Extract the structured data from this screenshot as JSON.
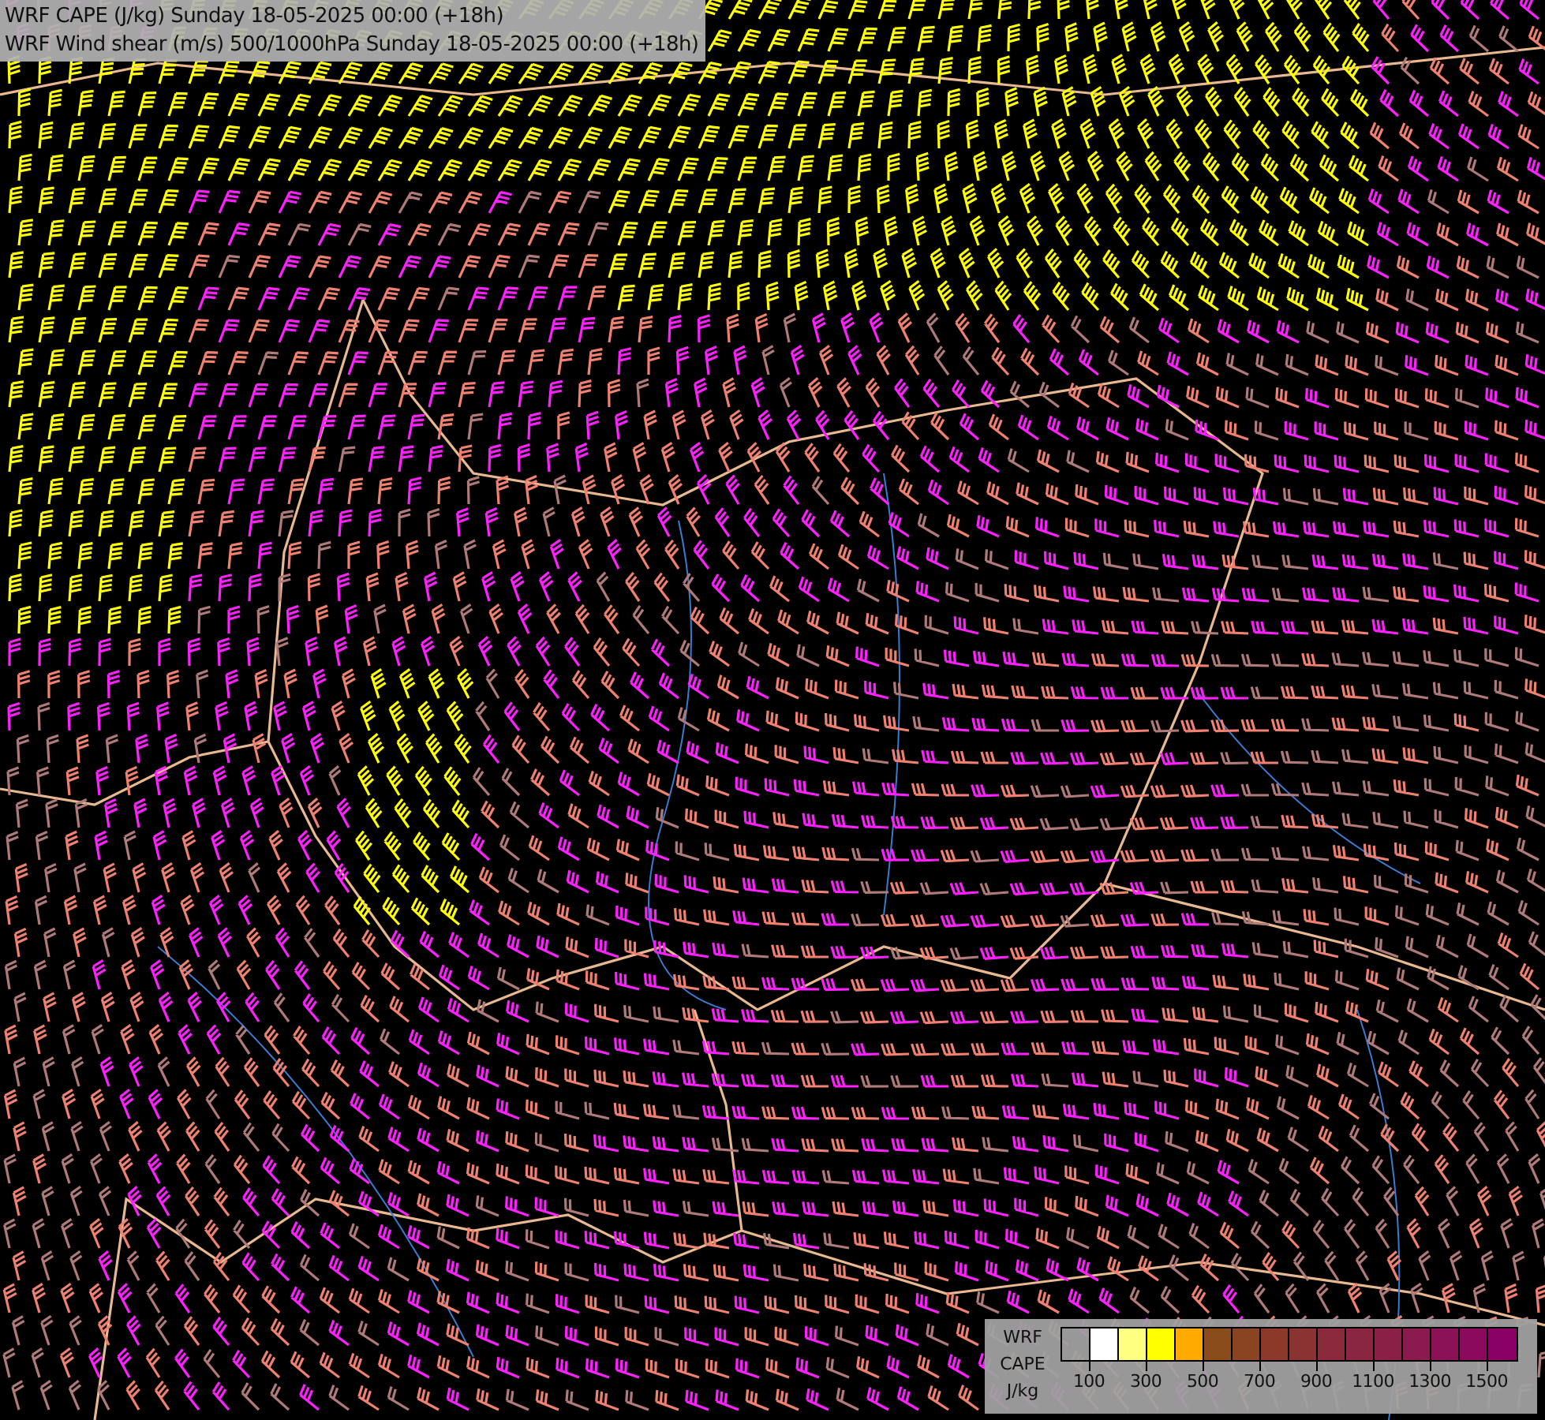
{
  "title_box": {
    "lines": [
      "WRF CAPE (J/kg) Sunday 18-05-2025 00:00 (+18h)",
      "WRF Wind shear (m/s) 500/1000hPa Sunday 18-05-2025 00:00 (+18h)"
    ]
  },
  "legend": {
    "label_lines": [
      "WRF",
      "CAPE",
      "J/kg"
    ],
    "swatches": [
      {
        "kind": "empty"
      },
      {
        "kind": "fill",
        "color": "#ffffff"
      },
      {
        "kind": "fill",
        "color": "#ffff80"
      },
      {
        "kind": "fill",
        "color": "#ffff00"
      },
      {
        "kind": "fill",
        "color": "#ffaa00"
      },
      {
        "kind": "fill",
        "color": "#8b4c1c"
      },
      {
        "kind": "fill",
        "color": "#8b4422"
      },
      {
        "kind": "fill",
        "color": "#8b3a2a"
      },
      {
        "kind": "fill",
        "color": "#8b3232"
      },
      {
        "kind": "fill",
        "color": "#8b2a3a"
      },
      {
        "kind": "fill",
        "color": "#8b2640"
      },
      {
        "kind": "fill",
        "color": "#8b2046"
      },
      {
        "kind": "fill",
        "color": "#8b1a4e"
      },
      {
        "kind": "fill",
        "color": "#8b1256"
      },
      {
        "kind": "fill",
        "color": "#8b0a5e"
      },
      {
        "kind": "fill",
        "color": "#8b0066"
      }
    ],
    "tick_labels": [
      "100",
      "300",
      "500",
      "700",
      "900",
      "1100",
      "1300",
      "1500"
    ]
  }
}
